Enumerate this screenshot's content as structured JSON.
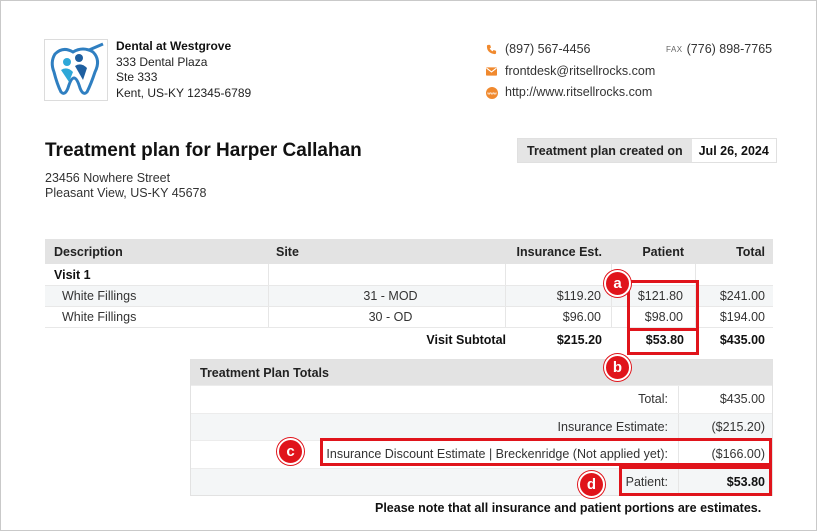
{
  "practice": {
    "name": "Dental at Westgrove",
    "address_lines": [
      "333 Dental Plaza",
      "Ste 333",
      "Kent, US-KY 12345-6789"
    ],
    "phone": "(897) 567-4456",
    "fax_label": "FAX",
    "fax": "(776) 898-7765",
    "email": "frontdesk@ritsellrocks.com",
    "website": "http://www.ritsellrocks.com"
  },
  "plan": {
    "title": "Treatment plan for Harper Callahan",
    "patient_address_lines": [
      "23456 Nowhere Street",
      "Pleasant View, US-KY 45678"
    ],
    "created_label": "Treatment plan created on",
    "created_date": "Jul 26, 2024"
  },
  "procedures": {
    "headers": {
      "description": "Description",
      "site": "Site",
      "insurance": "Insurance Est.",
      "patient": "Patient",
      "total": "Total"
    },
    "visit_label": "Visit 1",
    "rows": [
      {
        "description": "White Fillings",
        "site": "31 - MOD",
        "insurance": "$119.20",
        "patient": "$121.80",
        "total": "$241.00"
      },
      {
        "description": "White Fillings",
        "site": "30 - OD",
        "insurance": "$96.00",
        "patient": "$98.00",
        "total": "$194.00"
      }
    ],
    "subtotal": {
      "label": "Visit Subtotal",
      "insurance": "$215.20",
      "patient": "$53.80",
      "total": "$435.00"
    }
  },
  "totals": {
    "header": "Treatment Plan Totals",
    "rows": [
      {
        "label": "Total:",
        "value": "$435.00"
      },
      {
        "label": "Insurance Estimate:",
        "value": "($215.20)"
      },
      {
        "label": "Insurance Discount Estimate | Breckenridge (Not applied yet):",
        "value": "($166.00)"
      },
      {
        "label": "Patient:",
        "value": "$53.80"
      }
    ]
  },
  "note": "Please note that all insurance and patient portions are estimates.",
  "annotations": {
    "a": "a",
    "b": "b",
    "c": "c",
    "d": "d"
  },
  "colors": {
    "annotation_red": "#e0141b",
    "header_gray": "#e3e3e3",
    "accent_orange": "#f0892e",
    "logo_blue": "#2f7fc1"
  },
  "icons": {
    "phone": "phone-icon",
    "email": "email-icon",
    "web": "web-icon",
    "logo": "tooth-logo-icon"
  }
}
